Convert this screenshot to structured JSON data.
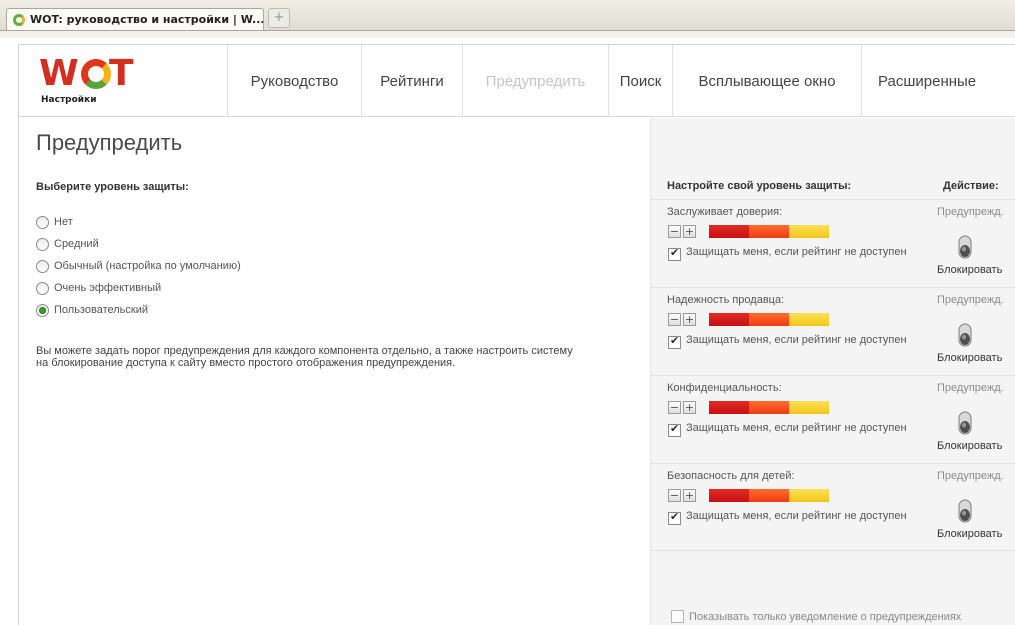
{
  "browser": {
    "tab_title": "WOT: руководство и настройки | W...",
    "new_tab_label": "+"
  },
  "header": {
    "logo_text": "WOT",
    "logo_subtitle": "Настройки",
    "nav": [
      {
        "label": "Руководство"
      },
      {
        "label": "Рейтинги"
      },
      {
        "label": "Предупредить",
        "active": true
      },
      {
        "label": "Поиск"
      },
      {
        "label": "Всплывающее окно"
      },
      {
        "label": "Расширенные"
      }
    ]
  },
  "main": {
    "title": "Предупредить",
    "level_label": "Выберите уровень защиты:",
    "levels": [
      {
        "label": "Нет",
        "selected": false
      },
      {
        "label": "Средний",
        "selected": false
      },
      {
        "label": "Обычный (настройка по умолчанию)",
        "selected": false
      },
      {
        "label": "Очень эффективный",
        "selected": false
      },
      {
        "label": "Пользовательский",
        "selected": true
      }
    ],
    "description": "Вы можете задать порог предупреждения для каждого компонента отдельно, а также настроить систему на блокирование доступа к сайту вместо простого отображения предупреждения."
  },
  "panel": {
    "header_left": "Настройте свой уровень защиты:",
    "header_action": "Действие:",
    "components": [
      {
        "name": "Заслуживает доверия:",
        "protect_label": "Защищать меня, если рейтинг не доступен",
        "protect_checked": true,
        "action_warn": "Предупрежд.",
        "action_block": "Блокировать"
      },
      {
        "name": "Надежность продавца:",
        "protect_label": "Защищать меня, если рейтинг не доступен",
        "protect_checked": true,
        "action_warn": "Предупрежд.",
        "action_block": "Блокировать"
      },
      {
        "name": "Конфиденциальность:",
        "protect_label": "Защищать меня, если рейтинг не доступен",
        "protect_checked": true,
        "action_warn": "Предупрежд.",
        "action_block": "Блокировать"
      },
      {
        "name": "Безопасность для детей:",
        "protect_label": "Защищать меня, если рейтинг не доступен",
        "protect_checked": true,
        "action_warn": "Предупрежд.",
        "action_block": "Блокировать"
      }
    ],
    "stepper_minus": "−",
    "stepper_plus": "+",
    "only_notification_label": "Показывать только уведомление о предупреждениях",
    "only_notification_checked": false
  },
  "colors": {
    "threshold_dark_red": "#c80f14",
    "threshold_orange": "#ed3b17",
    "threshold_yellow": "#f2c419",
    "radio_selected": "#2fa82f"
  },
  "icons": {
    "tab_favicon": "wot-favicon",
    "action_toggle": "toggle-switch-icon",
    "checkbox_check": "check-icon"
  }
}
